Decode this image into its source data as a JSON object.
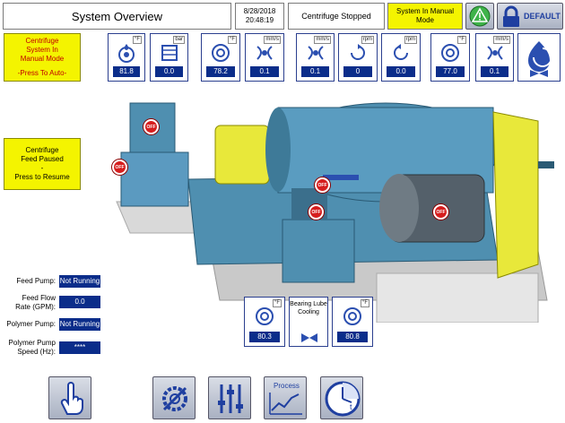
{
  "header": {
    "title": "System Overview",
    "date": "8/28/2018",
    "time": "20:48:19",
    "centrifuge_status": "Centrifuge Stopped",
    "mode_status": "System In Manual Mode",
    "user": "DEFAULT"
  },
  "left_panel": {
    "manual_mode": {
      "title": "Centrifuge System In Manual Mode",
      "action": "-Press To Auto-"
    },
    "feed_paused": {
      "line1": "Centrifuge Feed Paused",
      "dash": "-",
      "action": "Press to Resume"
    }
  },
  "top_gauges": [
    {
      "unit": "°F",
      "value": "81.8",
      "icon": "oil-temp-icon"
    },
    {
      "unit": "bar",
      "value": "0.0",
      "icon": "pressure-icon"
    },
    {
      "unit": "°F",
      "value": "78.2",
      "icon": "bearing-temp-icon"
    },
    {
      "unit": "mm/s",
      "value": "0.1",
      "icon": "vibration-icon"
    },
    {
      "unit": "mm/s",
      "value": "0.1",
      "icon": "vibration-icon"
    },
    {
      "unit": "rpm",
      "value": "0",
      "icon": "bowl-speed-icon"
    },
    {
      "unit": "rpm",
      "value": "0.0",
      "icon": "differential-speed-icon"
    },
    {
      "unit": "°F",
      "value": "77.0",
      "icon": "bearing-temp-icon"
    },
    {
      "unit": "mm/s",
      "value": "0.1",
      "icon": "vibration-icon"
    }
  ],
  "machine_labels": {
    "off": "OFF"
  },
  "bearing_panel": {
    "left": {
      "unit": "°F",
      "value": "80.3"
    },
    "middle_label": "Bearing Lube Cooling",
    "right": {
      "unit": "°F",
      "value": "80.8"
    }
  },
  "status_fields": [
    {
      "label": "Feed Pump:",
      "value": "Not Running"
    },
    {
      "label": "Feed Flow Rate (GPM):",
      "value": "0.0"
    },
    {
      "label": "Polymer Pump:",
      "value": "Not Running"
    },
    {
      "label": "Polymer Pump Speed (Hz):",
      "value": "****"
    }
  ],
  "bottom_nav": {
    "process_label": "Process",
    "clock_label": "t"
  },
  "colors": {
    "accent_yellow": "#f4f400",
    "value_blue": "#0b2d8a",
    "alarm_green": "#3fb34a",
    "lock_blue": "#1f3fa0",
    "off_red": "#d61e1e",
    "machine_blue": "#4f8fb0"
  }
}
